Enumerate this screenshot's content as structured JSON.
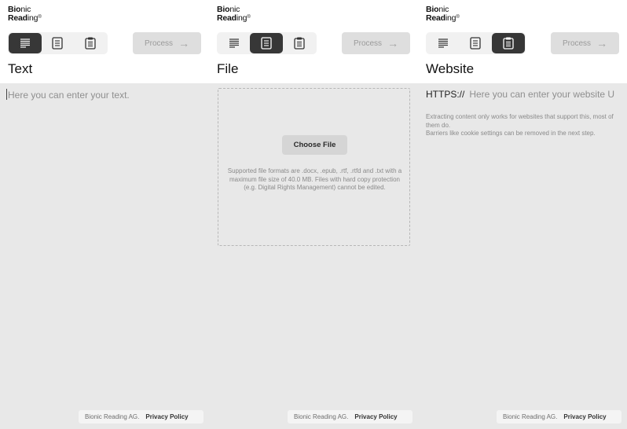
{
  "logo": {
    "line1_bold": "Bio",
    "line1_rest": "nic",
    "line2_bold": "Read",
    "line2_rest": "ing",
    "mark": "®"
  },
  "panels": [
    {
      "mode": "text",
      "title": "Text",
      "process_label": "Process",
      "placeholder": "Here you can enter your text.",
      "footer": {
        "company": "Bionic Reading AG.",
        "privacy": "Privacy Policy"
      }
    },
    {
      "mode": "file",
      "title": "File",
      "process_label": "Process",
      "choose_label": "Choose File",
      "formats_text": "Supported file formats are .docx, .epub, .rtf, .rtfd and .txt with a maximum file size of 40.0 MB. Files with hard copy protection (e.g. Digital Rights Management) cannot be edited.",
      "footer": {
        "company": "Bionic Reading AG.",
        "privacy": "Privacy Policy"
      }
    },
    {
      "mode": "website",
      "title": "Website",
      "process_label": "Process",
      "url_prefix": "HTTPS://",
      "url_placeholder": "Here you can enter your website U",
      "note_line1": "Extracting content only works for websites that support this, most of them do.",
      "note_line2": "Barriers like cookie settings can be removed in the next step.",
      "footer": {
        "company": "Bionic Reading AG.",
        "privacy": "Privacy Policy"
      }
    }
  ],
  "icons": {
    "text_mode": "text-lines-icon",
    "file_mode": "document-icon",
    "website_mode": "web-page-icon",
    "arrow": "arrow-right-icon"
  },
  "colors": {
    "active_segment": "#373737",
    "panel_bg": "#e8e8e8",
    "header_bg": "#ffffff",
    "disabled_button": "#dedede"
  }
}
